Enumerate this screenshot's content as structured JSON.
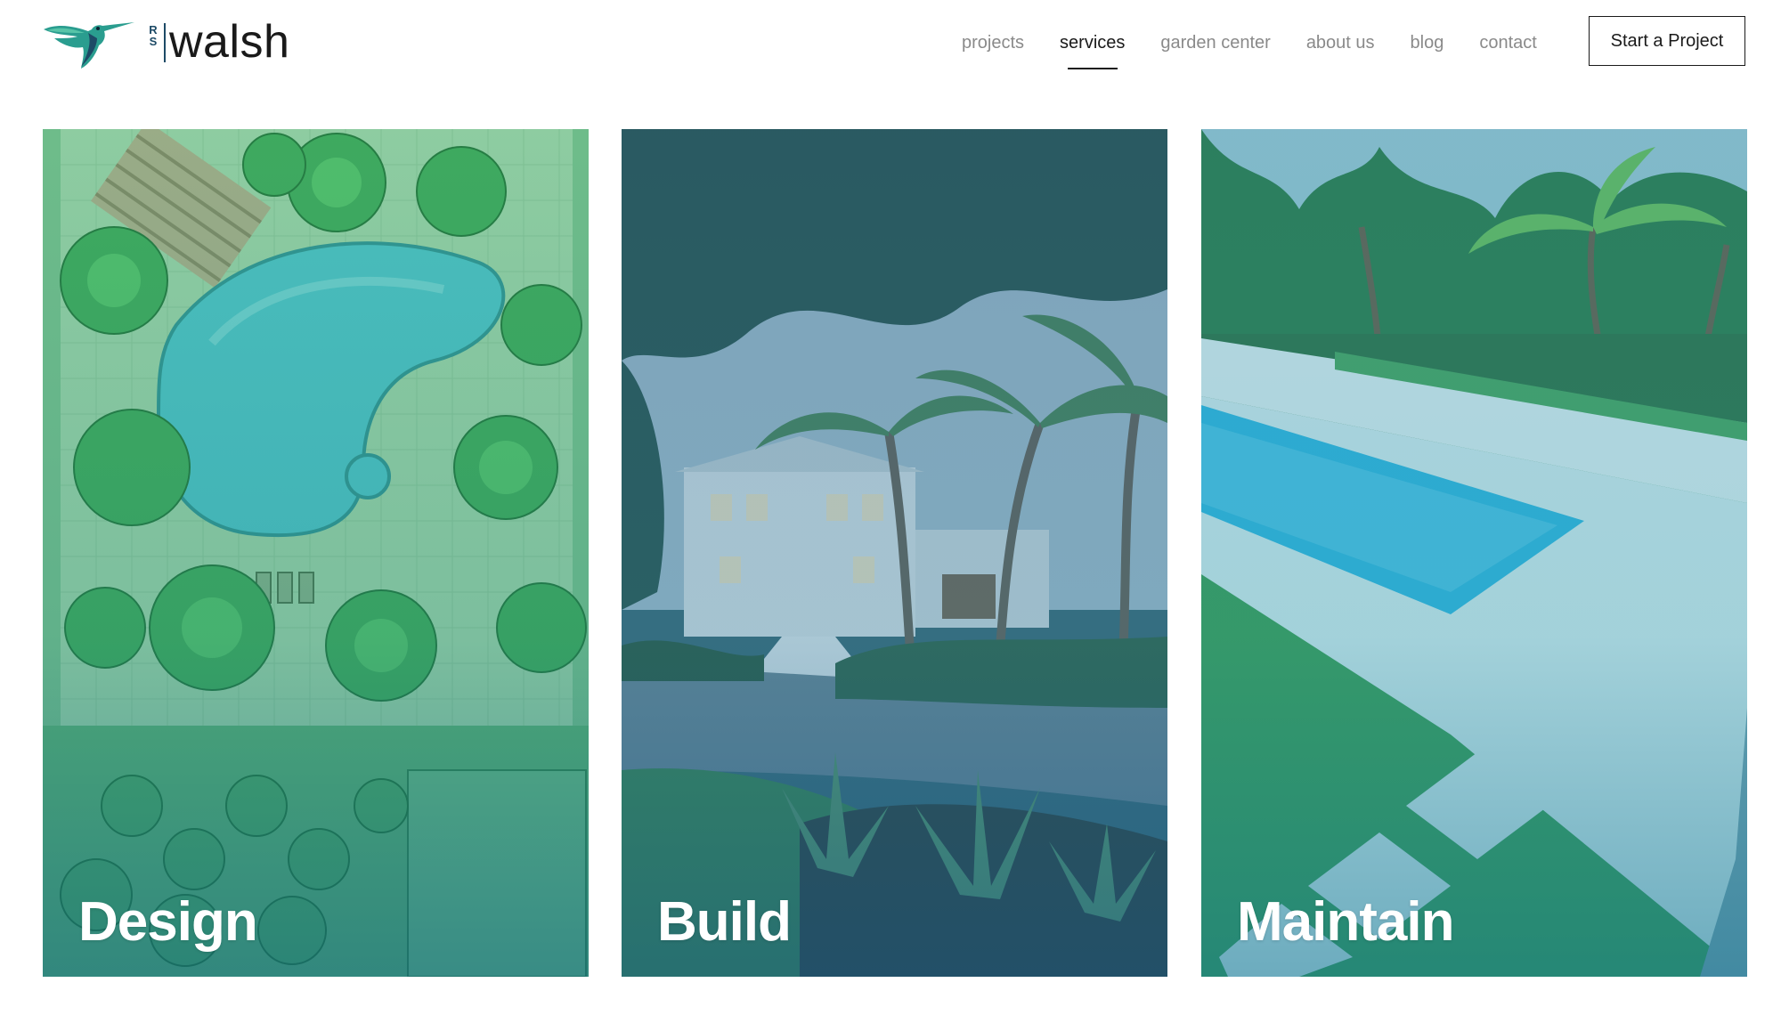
{
  "brand": {
    "initials_top": "R",
    "initials_bottom": "S",
    "wordmark": "walsh",
    "logo_icon": "hummingbird-icon",
    "accent_teal": "#1f8c8a",
    "accent_navy": "#1d4a66"
  },
  "nav": {
    "items": [
      {
        "label": "projects",
        "active": false
      },
      {
        "label": "services",
        "active": true
      },
      {
        "label": "garden center",
        "active": false
      },
      {
        "label": "about us",
        "active": false
      },
      {
        "label": "blog",
        "active": false
      },
      {
        "label": "contact",
        "active": false
      }
    ],
    "cta_label": "Start a Project"
  },
  "services": [
    {
      "label": "Design",
      "image": "landscape-plan-drawing-with-pool"
    },
    {
      "label": "Build",
      "image": "tropical-house-with-palms-driveway"
    },
    {
      "label": "Maintain",
      "image": "lap-pool-with-lawn-and-stepping-stones"
    }
  ]
}
